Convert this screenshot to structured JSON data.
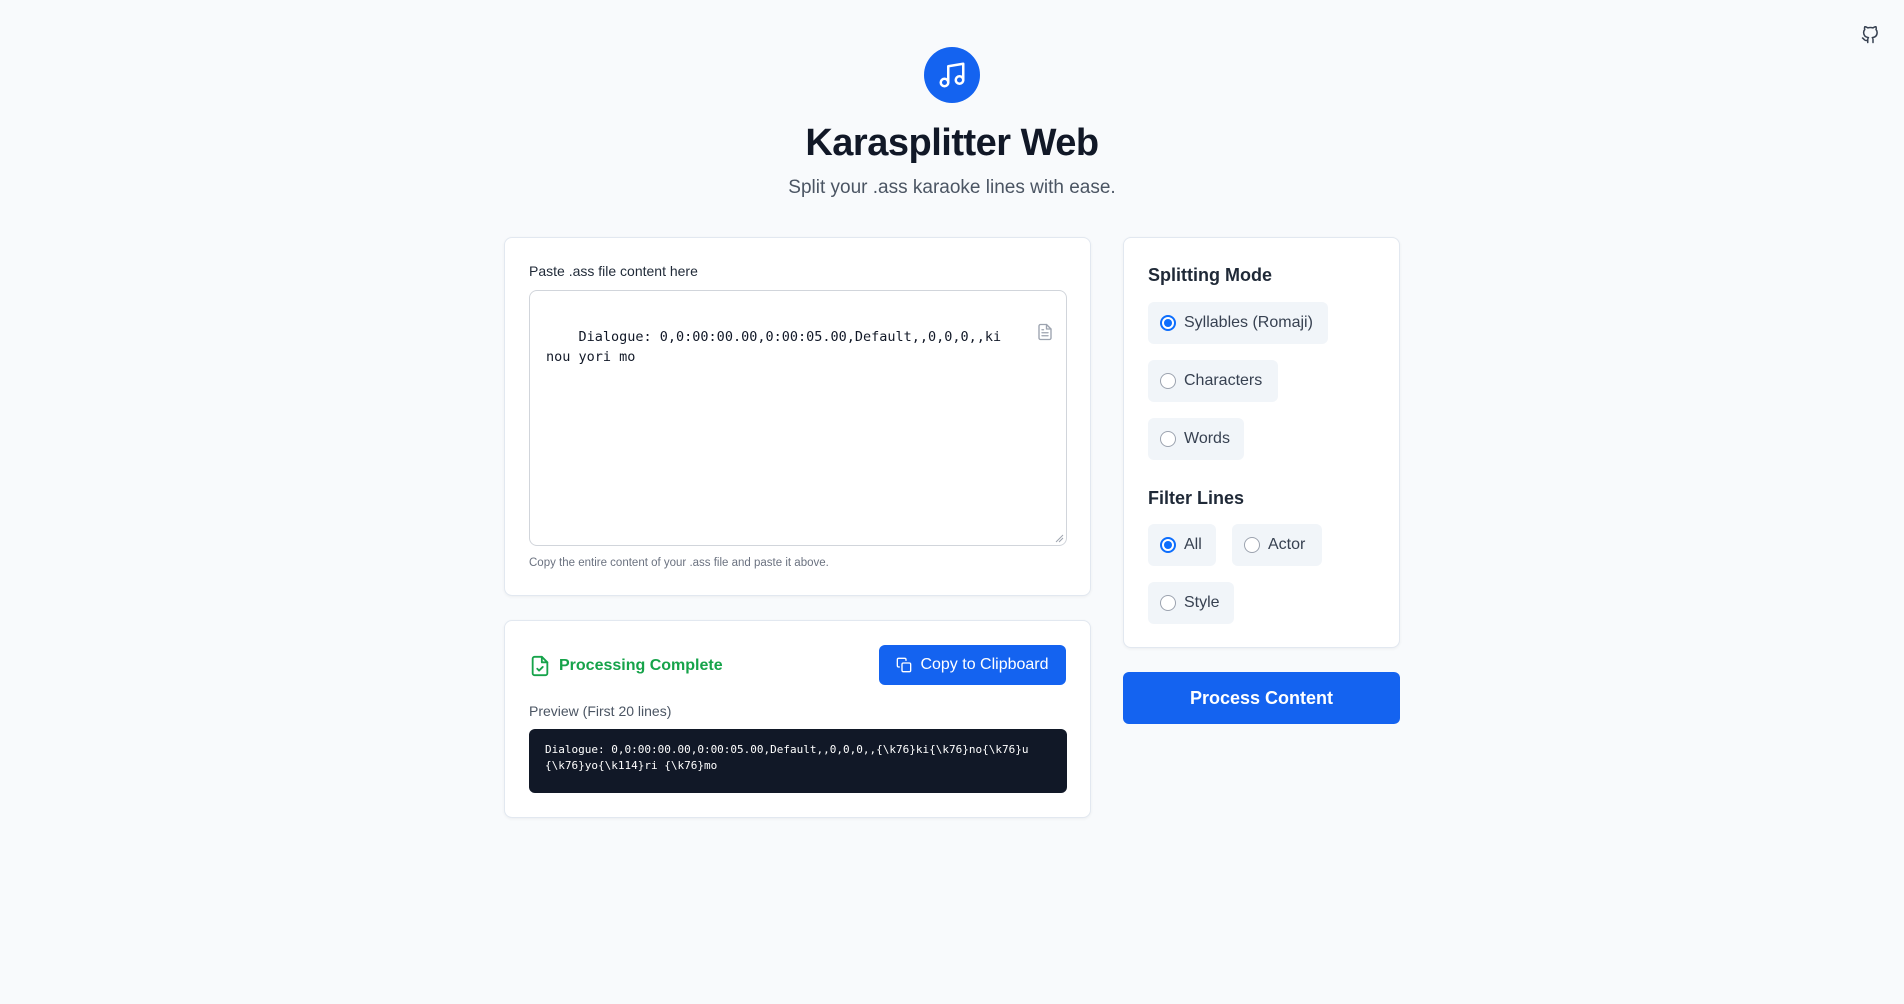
{
  "app": {
    "title": "Karasplitter Web",
    "subtitle": "Split your .ass karaoke lines with ease.",
    "logo_icon": "music-note-icon",
    "github_icon": "github-icon"
  },
  "input": {
    "label": "Paste .ass file content here",
    "value": "Dialogue: 0,0:00:00.00,0:00:05.00,Default,,0,0,0,,kinou yori mo",
    "help": "Copy the entire content of your .ass file and paste it above."
  },
  "output": {
    "status": "Processing Complete",
    "copy_label": "Copy to Clipboard",
    "preview_label": "Preview (First 20 lines)",
    "preview_text": "Dialogue: 0,0:00:00.00,0:00:05.00,Default,,0,0,0,,{\\k76}ki{\\k76}no{\\k76}u {\\k76}yo{\\k114}ri {\\k76}mo"
  },
  "options": {
    "splitting_title": "Splitting Mode",
    "splitting_modes": [
      {
        "label": "Syllables (Romaji)",
        "checked": true
      },
      {
        "label": "Characters",
        "checked": false
      },
      {
        "label": "Words",
        "checked": false
      }
    ],
    "filter_title": "Filter Lines",
    "filters": [
      {
        "label": "All",
        "checked": true
      },
      {
        "label": "Actor",
        "checked": false
      },
      {
        "label": "Style",
        "checked": false
      }
    ]
  },
  "process_label": "Process Content",
  "colors": {
    "accent": "#1463f0",
    "success": "#16a34a",
    "preview_bg": "#111827"
  }
}
